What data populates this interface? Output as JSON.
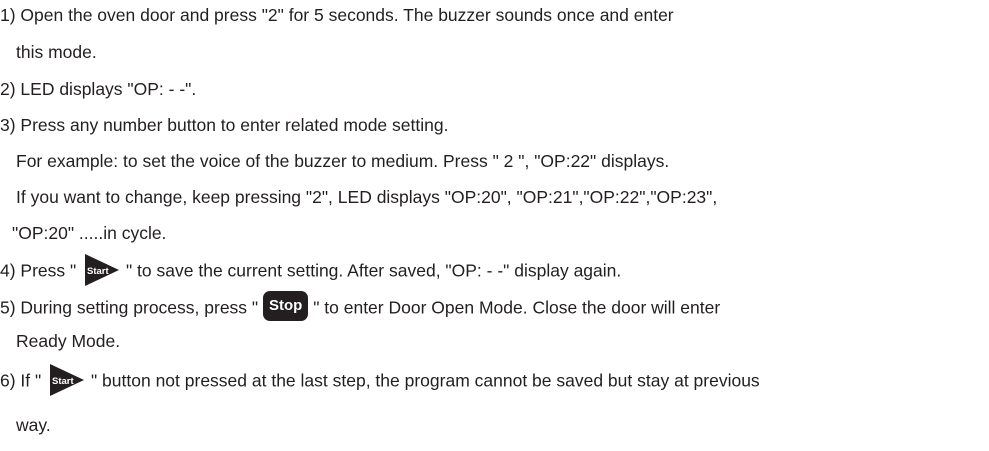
{
  "steps": {
    "s1a": "1)  Open the oven door and press \"2\" for 5 seconds. The buzzer sounds once and enter",
    "s1b": "this mode.",
    "s2": "2)  LED displays \"OP: - -\".",
    "s3": "3) Press any number button to enter related mode setting.",
    "s3b": "For example: to set the voice of the buzzer to medium. Press \" 2 \", \"OP:22\" displays.",
    "s3c": "If you want to change, keep pressing \"2\", LED displays \"OP:20\", \"OP:21\",\"OP:22\",\"OP:23\",",
    "s3d": "\"OP:20\" .....in cycle.",
    "s4_pre": "4) Press \"",
    "s4_post": "\" to save the current setting. After saved, \"OP: - -\" display again.",
    "s5_pre": "5) During setting process, press \"",
    "s5_post": "\" to enter Door Open Mode. Close the door will enter",
    "s5b": "Ready Mode.",
    "s6_pre": "6) If \"",
    "s6_post": "\" button not pressed at the last step, the program cannot be saved but stay at previous",
    "s6b": "way."
  },
  "buttons": {
    "start_label": "Start",
    "stop_label": "Stop"
  },
  "colors": {
    "text": "#231f20",
    "button": "#231f20"
  }
}
